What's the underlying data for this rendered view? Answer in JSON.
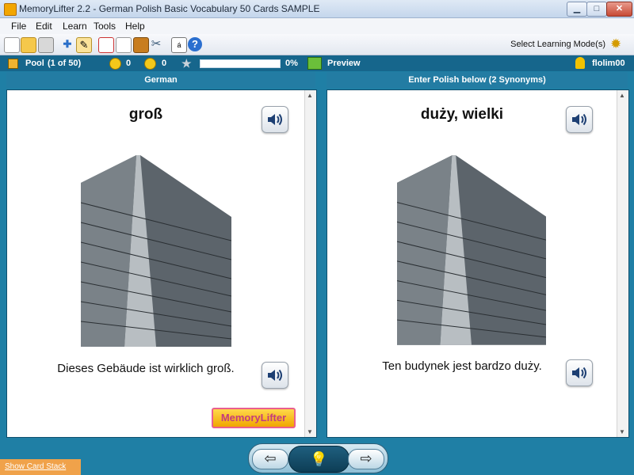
{
  "window": {
    "title": "MemoryLifter 2.2 - German Polish Basic Vocabulary 50 Cards SAMPLE"
  },
  "menu": [
    "File",
    "Edit",
    "Learn",
    "Tools",
    "Help"
  ],
  "toolbar": {
    "mode_label": "Select Learning Mode(s)"
  },
  "status": {
    "pool_label": "Pool",
    "pool_count": "(1 of 50)",
    "happy_count": "0",
    "sad_count": "0",
    "progress_label": "0%",
    "progress_value": 0,
    "preview_label": "Preview",
    "user": "flolim00"
  },
  "left": {
    "header": "German",
    "word": "groß",
    "sentence": "Dieses Gebäude ist wirklich groß.",
    "logo_text": "MemoryLifter"
  },
  "right": {
    "header": "Enter Polish below (2 Synonyms)",
    "word": "duży, wielki",
    "sentence": "Ten budynek jest bardzo duży."
  },
  "bottom": {
    "show_stack": "Show Card Stack"
  },
  "colors": {
    "accent": "#1f7fa5",
    "status_bar": "#16668c"
  }
}
